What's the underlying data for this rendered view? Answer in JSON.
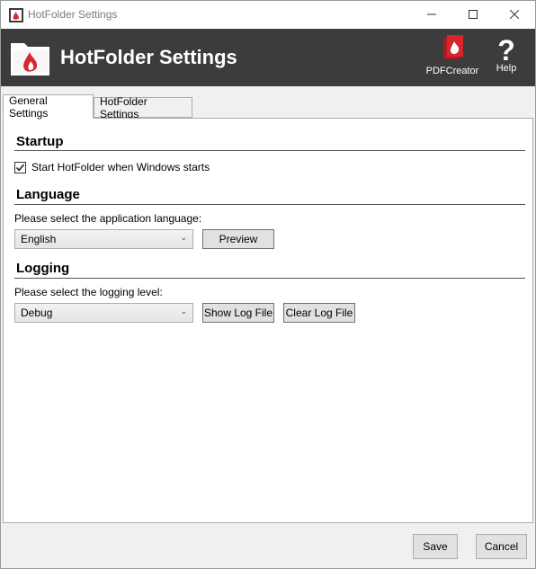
{
  "window": {
    "title": "HotFolder Settings",
    "icons": {
      "app": "pdfcreator-app-icon",
      "minimize": "minimize-icon",
      "maximize": "maximize-icon",
      "close": "close-icon"
    }
  },
  "header": {
    "title": "HotFolder Settings",
    "logo_icon": "folder-flame-icon",
    "buttons": [
      {
        "label": "PDFCreator",
        "icon": "pdfcreator-icon"
      },
      {
        "label": "Help",
        "icon": "help-icon"
      }
    ]
  },
  "tabs": [
    {
      "label": "General Settings",
      "active": true
    },
    {
      "label": "HotFolder Settings",
      "active": false
    }
  ],
  "startup": {
    "heading": "Startup",
    "checkbox_label": "Start HotFolder when Windows starts",
    "checked": true
  },
  "language": {
    "heading": "Language",
    "prompt": "Please select the application language:",
    "selected": "English",
    "preview_button": "Preview"
  },
  "logging": {
    "heading": "Logging",
    "prompt": "Please select the logging level:",
    "selected": "Debug",
    "show_log_button": "Show Log File",
    "clear_log_button": "Clear Log File"
  },
  "footer": {
    "save_label": "Save",
    "cancel_label": "Cancel"
  },
  "colors": {
    "banner": "#3c3c3c",
    "accent_red": "#d7262e"
  }
}
